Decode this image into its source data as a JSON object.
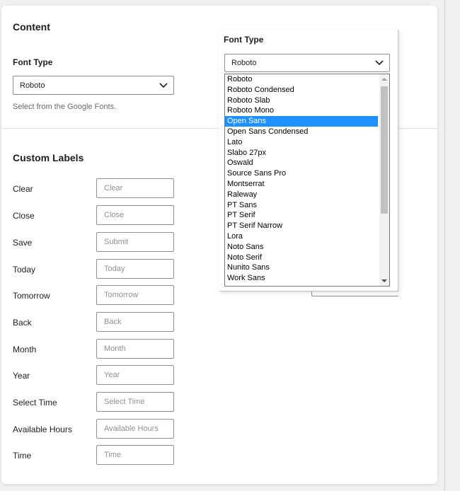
{
  "content": {
    "title": "Content",
    "font_type_label": "Font Type",
    "font_type_value": "Roboto",
    "help_text": "Select from the Google Fonts."
  },
  "custom_labels": {
    "title": "Custom Labels",
    "rows": [
      {
        "label": "Clear",
        "placeholder": "Clear"
      },
      {
        "label": "Close",
        "placeholder": "Close"
      },
      {
        "label": "Save",
        "placeholder": "Submit"
      },
      {
        "label": "Today",
        "placeholder": "Today"
      },
      {
        "label": "Tomorrow",
        "placeholder": "Tomorrow"
      },
      {
        "label": "Back",
        "placeholder": "Back"
      },
      {
        "label": "Month",
        "placeholder": "Month"
      },
      {
        "label": "Year",
        "placeholder": "Year"
      },
      {
        "label": "Select Time",
        "placeholder": "Select Time"
      },
      {
        "label": "Available Hours",
        "placeholder": "Available Hours"
      },
      {
        "label": "Time",
        "placeholder": "Time"
      }
    ]
  },
  "dropdown": {
    "title": "Font Type",
    "value": "Roboto",
    "selected_index": 4,
    "options": [
      "Roboto",
      "Roboto Condensed",
      "Roboto Slab",
      "Roboto Mono",
      "Open Sans",
      "Open Sans Condensed",
      "Lato",
      "Slabo 27px",
      "Oswald",
      "Source Sans Pro",
      "Montserrat",
      "Raleway",
      "PT Sans",
      "PT Serif",
      "PT Serif Narrow",
      "Lora",
      "Noto Sans",
      "Noto Serif",
      "Nunito Sans",
      "Work Sans"
    ]
  },
  "icons": {
    "select_chevron": "chevron-down-icon",
    "scroll_up": "scroll-up-arrow-icon",
    "scroll_down": "scroll-down-arrow-icon"
  },
  "colors": {
    "highlight": "#1e90ff",
    "border": "#8c8f94",
    "background": "#f0f0f1"
  }
}
